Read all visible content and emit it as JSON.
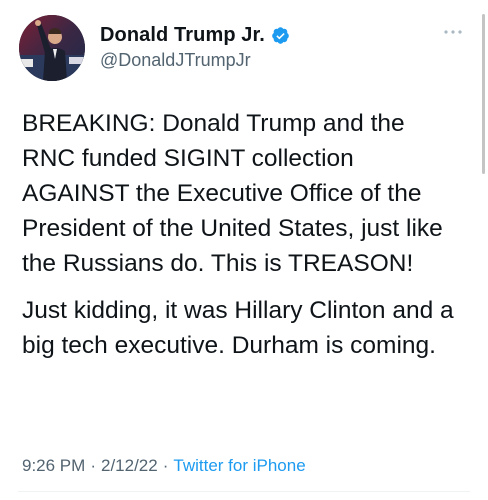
{
  "author": {
    "display_name": "Donald Trump Jr.",
    "handle": "@DonaldJTrumpJr",
    "verified": true,
    "avatar_icon": "profile-photo",
    "verified_icon": "verified-badge-icon"
  },
  "tweet": {
    "paragraphs": [
      "BREAKING: Donald Trump and the RNC funded SIGINT collection AGAINST the Executive Office of the President of the United States, just like the Russians do. This is TREASON!",
      "Just kidding, it was Hillary Clinton and a big tech executive. Durham is coming."
    ],
    "time": "9:26 PM",
    "date": "2/12/22",
    "separator": "·",
    "source": "Twitter for iPhone"
  },
  "colors": {
    "text": "#0f1419",
    "secondary": "#536471",
    "link": "#1d9bf0",
    "verified": "#1d9bf0"
  },
  "icons": {
    "more": "more-horizontal-icon"
  }
}
